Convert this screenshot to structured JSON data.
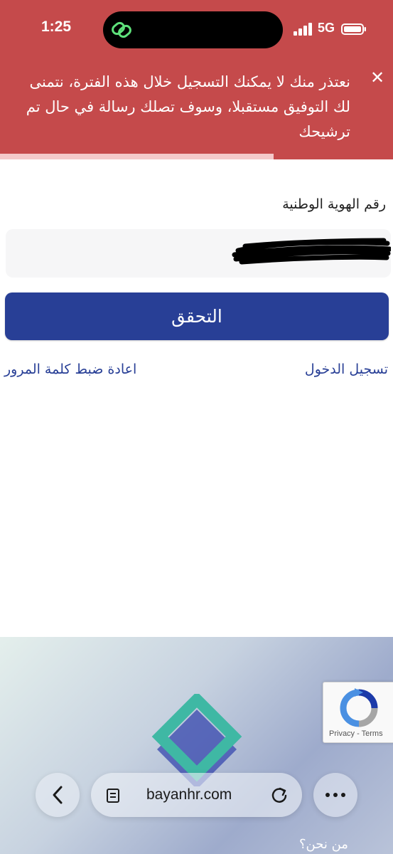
{
  "status_bar": {
    "time": "1:25",
    "network": "5G",
    "icons": [
      "link-icon",
      "signal-icon",
      "battery-icon"
    ]
  },
  "alert": {
    "message": "نعتذر منك لا يمكنك التسجيل خلال هذه الفترة، نتمنى لك التوفيق مستقبلا، وسوف تصلك رسالة في حال تم ترشيحك",
    "close_icon": "close-icon",
    "background_color": "#c54a4b"
  },
  "form": {
    "id_label": "رقم الهوية الوطنية",
    "id_value_redacted": true,
    "verify_label": "التحقق",
    "register_link": "تسجيل الدخول",
    "reset_link": "اعادة ضبط كلمة المرور",
    "accent_color": "#283f96"
  },
  "footer": {
    "about": "من نحن؟"
  },
  "recaptcha": {
    "privacy": "Privacy",
    "separator": " - ",
    "terms": "Terms"
  },
  "browser": {
    "url": "bayanhr.com",
    "icons": [
      "back-icon",
      "page-icon",
      "reload-icon",
      "more-icon"
    ]
  }
}
